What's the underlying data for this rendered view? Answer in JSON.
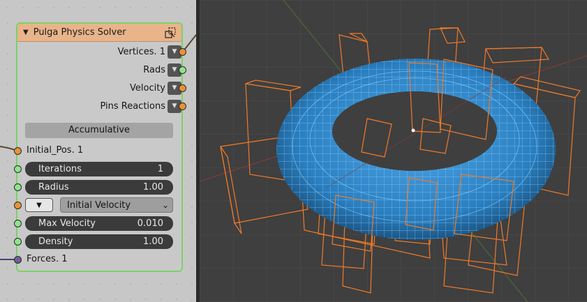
{
  "node": {
    "title": "Pulga Physics Solver",
    "outputs": [
      {
        "label": "Vertices. 1",
        "socket": "orange"
      },
      {
        "label": "Rads",
        "socket": "green"
      },
      {
        "label": "Velocity",
        "socket": "orange"
      },
      {
        "label": "Pins Reactions",
        "socket": "orange"
      }
    ],
    "mode_button": "Accumulative",
    "inputs": {
      "initial_pos": "Initial_Pos. 1",
      "iterations": {
        "label": "Iterations",
        "value": "1"
      },
      "radius": {
        "label": "Radius",
        "value": "1.00"
      },
      "initial_velocity": {
        "selected": "Initial Velocity"
      },
      "max_velocity": {
        "label": "Max Velocity",
        "value": "0.010"
      },
      "density": {
        "label": "Density",
        "value": "1.00"
      },
      "forces": "Forces. 1"
    }
  },
  "icons": {
    "collapse": "chevron-down-icon",
    "node_menu": "node-options-icon",
    "dropdown": "triangle-down-icon",
    "select": "chevron-down-icon"
  },
  "colors": {
    "header": "#e9b48a",
    "node_border": "#7bd16b",
    "socket_orange": "#e8913a",
    "socket_green": "#8fe38c",
    "socket_purple": "#6e5f9b",
    "mesh_blue": "#2b82c4",
    "wireframe_orange": "#f07a2a"
  }
}
